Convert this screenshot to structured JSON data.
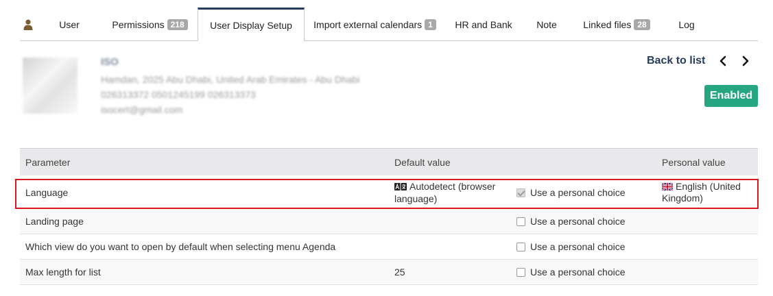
{
  "tabs": [
    {
      "label": "User",
      "badge": ""
    },
    {
      "label": "Permissions",
      "badge": "218"
    },
    {
      "label": "User Display Setup",
      "badge": ""
    },
    {
      "label": "Import external calendars",
      "badge": "1"
    },
    {
      "label": "HR and Bank",
      "badge": ""
    },
    {
      "label": "Note",
      "badge": ""
    },
    {
      "label": "Linked files",
      "badge": "28"
    },
    {
      "label": "Log",
      "badge": ""
    }
  ],
  "card": {
    "name": "ISO",
    "address": "Hamdan, 2025 Abu Dhabi, United Arab Emirates - Abu Dhabi",
    "phones": "026313372   0501245199   026313373",
    "email": "isocert@gmail.com"
  },
  "header": {
    "back_to_list": "Back to list",
    "prev": "<",
    "next": ">",
    "status": "Enabled"
  },
  "table": {
    "headers": {
      "parameter": "Parameter",
      "default": "Default value",
      "personal": "Personal value"
    },
    "rows": [
      {
        "parameter": "Language",
        "default": "Autodetect (browser language)",
        "choice": "Use a personal choice",
        "checked": true,
        "personal": "English (United Kingdom)"
      },
      {
        "parameter": "Landing page",
        "default": "",
        "choice": "Use a personal choice",
        "checked": false,
        "personal": ""
      },
      {
        "parameter": "Which view do you want to open by default when selecting menu Agenda",
        "default": "",
        "choice": "Use a personal choice",
        "checked": false,
        "personal": ""
      },
      {
        "parameter": "Max length for list",
        "default": "25",
        "choice": "Use a personal choice",
        "checked": false,
        "personal": ""
      }
    ]
  },
  "colors": {
    "accent": "#263c5c",
    "enabled": "#25a580",
    "highlight": "#e0141c"
  }
}
